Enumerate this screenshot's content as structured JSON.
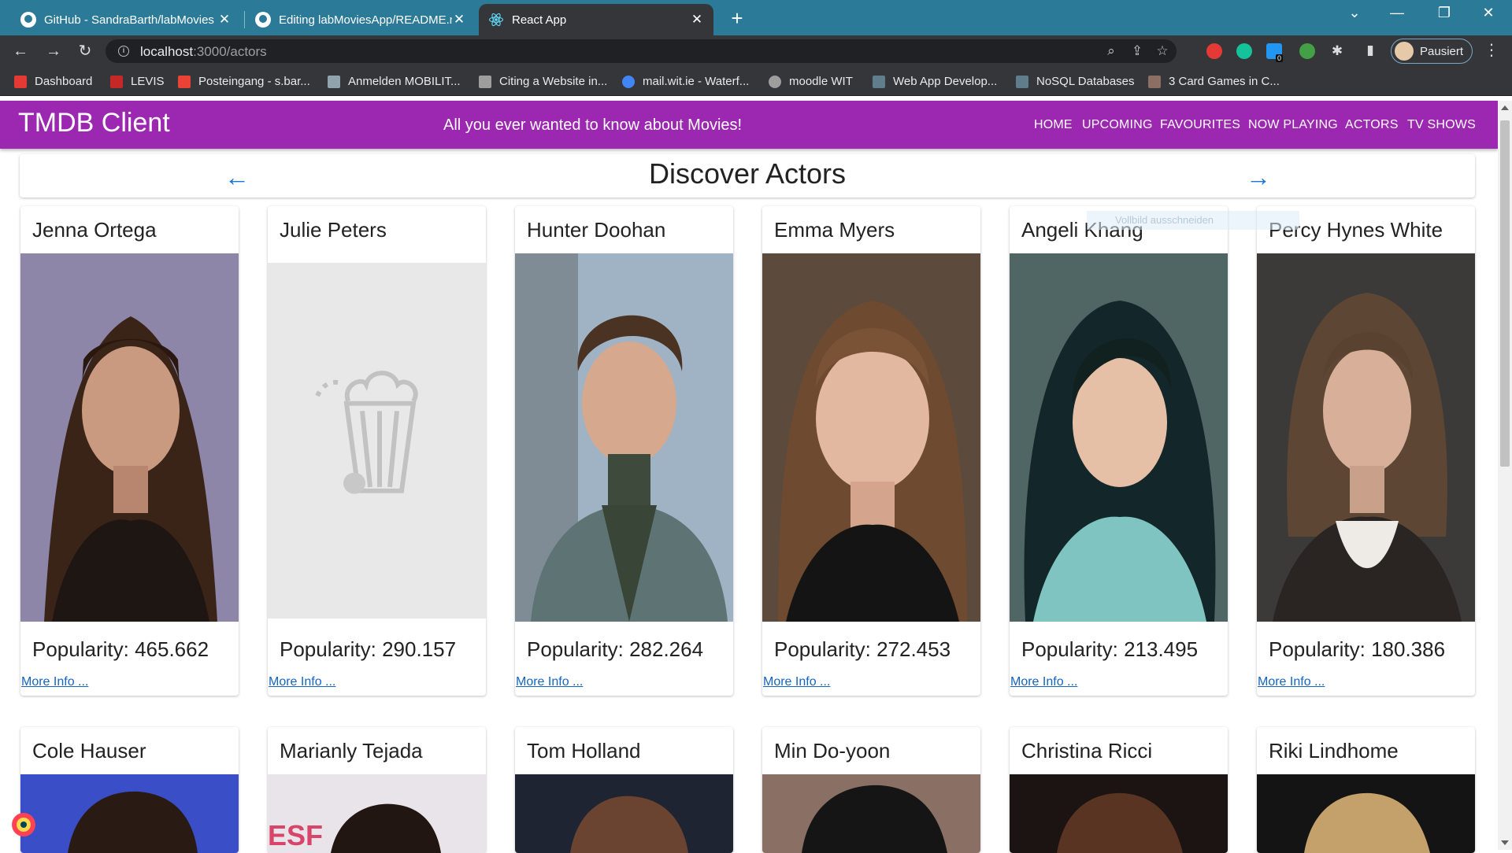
{
  "browser": {
    "tabs": [
      {
        "title": "GitHub - SandraBarth/labMovies",
        "icon": "github-icon"
      },
      {
        "title": "Editing labMoviesApp/README.md",
        "icon": "github-icon"
      },
      {
        "title": "React App",
        "icon": "react-icon"
      }
    ],
    "url_host": "localhost",
    "url_path": ":3000/actors",
    "profile_label": "Pausiert",
    "extension_badge": "0",
    "bookmarks": [
      {
        "label": "Dashboard",
        "color": "#e53935"
      },
      {
        "label": "LEVIS",
        "color": "#c62828"
      },
      {
        "label": "Posteingang - s.bar...",
        "color": "#ea4335"
      },
      {
        "label": "Anmelden MOBILIT...",
        "color": "#90a4ae"
      },
      {
        "label": "Citing a Website in...",
        "color": "#9e9e9e"
      },
      {
        "label": "mail.wit.ie - Waterf...",
        "color": "#4285f4"
      },
      {
        "label": "moodle WIT",
        "color": "#9e9e9e"
      },
      {
        "label": "Web App Develop...",
        "color": "#607d8b"
      },
      {
        "label": "NoSQL Databases",
        "color": "#607d8b"
      },
      {
        "label": "3 Card Games in C...",
        "color": "#8d6e63"
      }
    ]
  },
  "app": {
    "title": "TMDB Client",
    "tagline": "All you ever wanted to know about Movies!",
    "nav": [
      "HOME",
      "UPCOMING",
      "FAVOURITES",
      "NOW PLAYING",
      "ACTORS",
      "TV SHOWS"
    ],
    "colors": {
      "appbar": "#9c27b0",
      "arrow": "#1976d2",
      "link": "#1565c0"
    }
  },
  "page": {
    "title": "Discover Actors",
    "ghost_text": "Vollbild ausschneiden"
  },
  "actors_row1": [
    {
      "name": "Jenna Ortega",
      "popularity": "Popularity: 465.662",
      "more": "More Info ..."
    },
    {
      "name": "Julie Peters",
      "popularity": "Popularity: 290.157",
      "more": "More Info ..."
    },
    {
      "name": "Hunter Doohan",
      "popularity": "Popularity: 282.264",
      "more": "More Info ..."
    },
    {
      "name": "Emma Myers",
      "popularity": "Popularity: 272.453",
      "more": "More Info ..."
    },
    {
      "name": "Angeli Khang",
      "popularity": "Popularity: 213.495",
      "more": "More Info ..."
    },
    {
      "name": "Percy Hynes White",
      "popularity": "Popularity: 180.386",
      "more": "More Info ..."
    }
  ],
  "actors_row2": [
    {
      "name": "Cole Hauser"
    },
    {
      "name": "Marianly Tejada"
    },
    {
      "name": "Tom Holland"
    },
    {
      "name": "Min Do-yoon"
    },
    {
      "name": "Christina Ricci"
    },
    {
      "name": "Riki Lindhome"
    }
  ]
}
